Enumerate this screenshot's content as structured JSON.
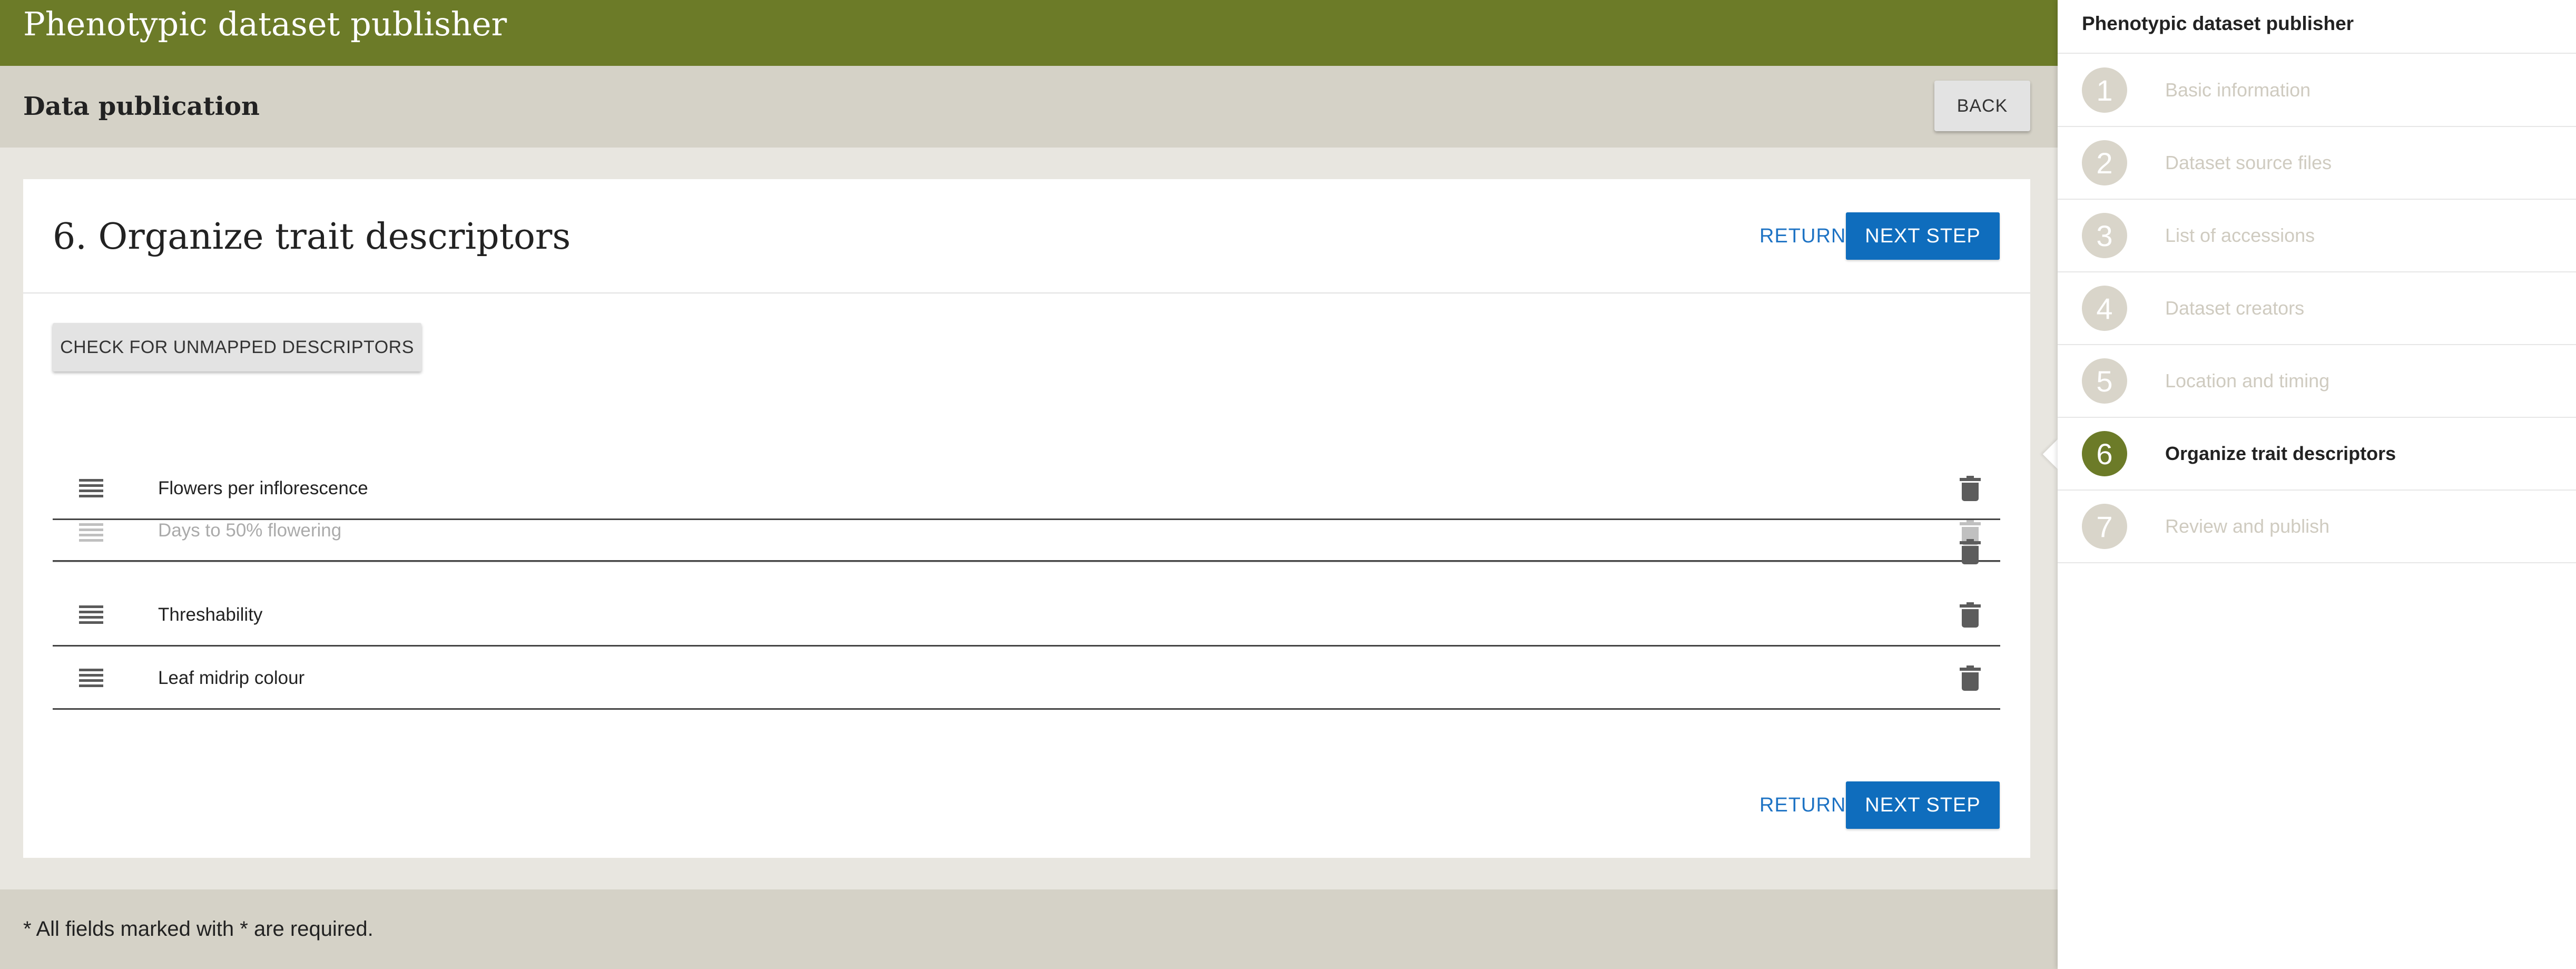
{
  "app": {
    "title": "Phenotypic dataset publisher"
  },
  "subheader": {
    "title": "Data publication",
    "back_label": "BACK"
  },
  "card": {
    "title": "6. Organize trait descriptors",
    "return_label": "RETURN",
    "next_label": "NEXT STEP",
    "check_label": "CHECK FOR UNMAPPED DESCRIPTORS",
    "descriptors": [
      {
        "label": "Flowers per inflorescence",
        "state": "normal"
      },
      {
        "label": "Days to 50% flowering",
        "state": "dragging"
      },
      {
        "label": "Threshability",
        "state": "normal"
      },
      {
        "label": "Leaf midrip colour",
        "state": "normal"
      }
    ]
  },
  "footer": {
    "note": "* All fields marked with * are required."
  },
  "stepper": {
    "title": "Phenotypic dataset publisher",
    "active_step": 6,
    "steps": [
      {
        "number": "1",
        "label": "Basic information"
      },
      {
        "number": "2",
        "label": "Dataset source files"
      },
      {
        "number": "3",
        "label": "List of accessions"
      },
      {
        "number": "4",
        "label": "Dataset creators"
      },
      {
        "number": "5",
        "label": "Location and timing"
      },
      {
        "number": "6",
        "label": "Organize trait descriptors"
      },
      {
        "number": "7",
        "label": "Review and publish"
      }
    ]
  },
  "colors": {
    "header_green": "#6c7b28",
    "subheader_beige": "#d5d2c7",
    "primary_blue": "#0f6dbd",
    "link_blue": "#1e73c4",
    "inactive_step": "#d9d5ca"
  },
  "icons": {
    "drag_handle": "drag-handle-icon",
    "delete": "trash-icon"
  }
}
